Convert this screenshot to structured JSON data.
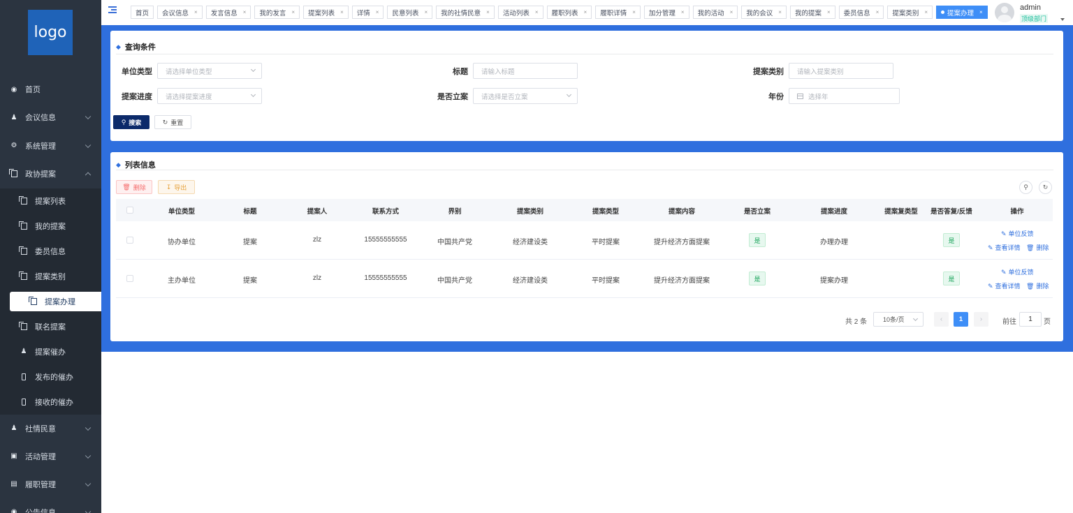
{
  "sidebar": {
    "logo_text": "logo",
    "items": [
      {
        "label": "首页",
        "icon": "dashboard-icon"
      },
      {
        "label": "会议信息",
        "icon": "people-icon"
      },
      {
        "label": "系统管理",
        "icon": "gear-icon"
      },
      {
        "label": "政协提案",
        "icon": "document-icon"
      }
    ],
    "sub_items": [
      {
        "label": "提案列表"
      },
      {
        "label": "我的提案"
      },
      {
        "label": "委员信息"
      },
      {
        "label": "提案类别"
      },
      {
        "label": "提案办理"
      },
      {
        "label": "联名提案"
      },
      {
        "label": "提案催办"
      },
      {
        "label": "发布的催办"
      },
      {
        "label": "接收的催办"
      }
    ],
    "bottom_items": [
      {
        "label": "社情民意"
      },
      {
        "label": "活动管理"
      },
      {
        "label": "履职管理"
      },
      {
        "label": "公告信息"
      }
    ]
  },
  "tabs": [
    "首页",
    "会议信息",
    "发言信息",
    "我的发言",
    "提案列表",
    "详情",
    "民意列表",
    "我的社情民意",
    "活动列表",
    "履职列表",
    "履职详情",
    "加分管理",
    "我的活动",
    "我的会议",
    "我的提案",
    "委员信息",
    "提案类别",
    "提案办理"
  ],
  "user": {
    "name": "admin",
    "dept": "顶级部门"
  },
  "query": {
    "title": "查询条件",
    "unit_type_label": "单位类型",
    "unit_type_placeholder": "请选择单位类型",
    "title_label": "标题",
    "title_placeholder": "请输入标题",
    "category_label": "提案类别",
    "category_placeholder": "请输入提案类别",
    "progress_label": "提案进度",
    "progress_placeholder": "请选择提案进度",
    "filed_label": "是否立案",
    "filed_placeholder": "请选择是否立案",
    "year_label": "年份",
    "year_placeholder": "选择年",
    "search_label": "搜索",
    "reset_label": "重置"
  },
  "list": {
    "title": "列表信息",
    "delete_label": "删除",
    "export_label": "导出",
    "columns": [
      "单位类型",
      "标题",
      "提案人",
      "联系方式",
      "界别",
      "提案类别",
      "提案类型",
      "提案内容",
      "是否立案",
      "提案进度",
      "提案复类型",
      "是否答复/反馈",
      "操作"
    ],
    "rows": [
      {
        "unit_type": "协办单位",
        "title": "提案",
        "proposer": "zlz",
        "phone": "15555555555",
        "sector": "中国共产党",
        "category": "经济建设类",
        "type": "平时提案",
        "content": "提升经济方面提案",
        "filed": "是",
        "progress": "办理办理",
        "reply_type": "",
        "answered": "是"
      },
      {
        "unit_type": "主办单位",
        "title": "提案",
        "proposer": "zlz",
        "phone": "15555555555",
        "sector": "中国共产党",
        "category": "经济建设类",
        "type": "平时提案",
        "content": "提升经济方面提案",
        "filed": "是",
        "progress": "提案办理",
        "reply_type": "",
        "answered": "是"
      }
    ],
    "ops": {
      "feedback": "单位反馈",
      "detail": "查看详情",
      "delete": "删除"
    }
  },
  "pager": {
    "total": "共 2 条",
    "page_size": "10条/页",
    "current_page": "1",
    "goto_label": "前往",
    "goto_value": "1",
    "page_suffix": "页"
  }
}
